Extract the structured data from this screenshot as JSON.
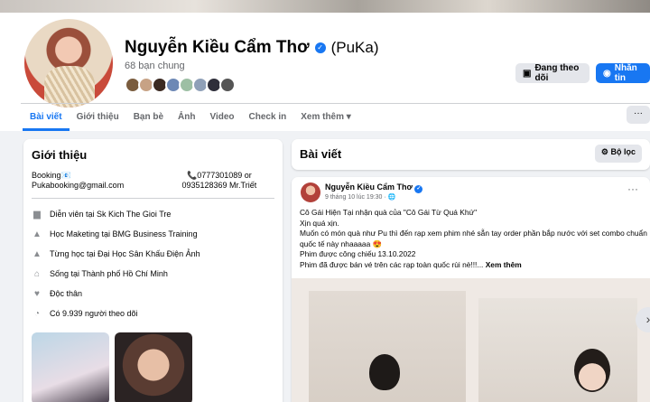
{
  "profile": {
    "name": "Nguyễn Kiều Cẩm Thơ",
    "nickname": "(PuKa)",
    "mutual_friends": "68 bạn chung",
    "verified": true
  },
  "actions": {
    "following": "Đang theo dõi",
    "message": "Nhắn tin"
  },
  "tabs": [
    "Bài viết",
    "Giới thiệu",
    "Bạn bè",
    "Ảnh",
    "Video",
    "Check in",
    "Xem thêm"
  ],
  "tab_more_menu": "···",
  "intro": {
    "title": "Giới thiệu",
    "contact_left": "Booking📧 Pukabooking@gmail.com",
    "contact_right": "📞0777301089 or 0935128369 Mr.Triết",
    "items": [
      {
        "icon": "briefcase-icon",
        "text": "Diễn viên tại Sk Kich The Gioi Tre"
      },
      {
        "icon": "graduation-cap-icon",
        "text": "Học Maketing tại BMG Business Training"
      },
      {
        "icon": "graduation-cap-icon",
        "text": "Từng học tại Đại Học Sân Khấu Điện Ảnh"
      },
      {
        "icon": "home-icon",
        "text": "Sống tại Thành phố Hồ Chí Minh"
      },
      {
        "icon": "heart-icon",
        "text": "Độc thân"
      },
      {
        "icon": "rss-icon",
        "text": "Có 9.939 người theo dõi"
      }
    ]
  },
  "posts": {
    "title": "Bài viết",
    "filter": "Bộ lọc"
  },
  "post": {
    "author": "Nguyễn Kiều Cẩm Thơ",
    "meta": "9 tháng 10 lúc 19:30 · 🌐",
    "lines": [
      "Cô Gái Hiện Tại nhận quà của \"Cô Gái Từ Quá Khứ\"",
      "Xịn quá xịn.",
      "Muốn có món quà như Pu thì đến rạp xem phim nhé sẵn tay order phần bắp nước với set combo chuẩn quốc tế này nhaaaaa 😍",
      "Phim được công chiếu 13.10.2022",
      "Phim đã được bán vé trên các rạp toàn quốc rùi nè!!!..."
    ],
    "see_more": "Xem thêm"
  },
  "colors": {
    "accent": "#1877f2",
    "background": "#f0f2f5"
  }
}
